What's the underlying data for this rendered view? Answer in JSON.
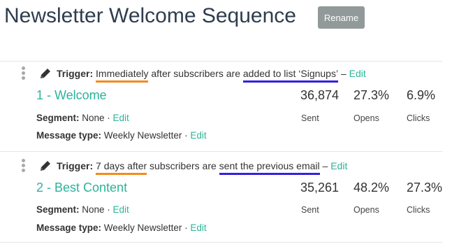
{
  "page": {
    "title": "Newsletter Welcome Sequence",
    "rename_label": "Rename"
  },
  "emails": [
    {
      "trigger_label": "Trigger:",
      "trigger_when": "Immediately",
      "trigger_mid": " after subscribers are ",
      "trigger_action": "added to list ‘Signups’",
      "trigger_sep": " – ",
      "trigger_edit": "Edit",
      "name": "1 - Welcome",
      "segment_label": "Segment:",
      "segment_value": " None · ",
      "segment_edit": "Edit",
      "type_label": "Message type:",
      "type_value": " Weekly Newsletter · ",
      "type_edit": "Edit",
      "sent": "36,874",
      "sent_label": "Sent",
      "opens": "27.3%",
      "opens_label": "Opens",
      "clicks": "6.9%",
      "clicks_label": "Clicks"
    },
    {
      "trigger_label": "Trigger:",
      "trigger_when": "7 days after",
      "trigger_mid": " subscribers are ",
      "trigger_action": "sent the previous email",
      "trigger_sep": " – ",
      "trigger_edit": "Edit",
      "name": "2 - Best Content",
      "segment_label": "Segment:",
      "segment_value": " None · ",
      "segment_edit": "Edit",
      "type_label": "Message type:",
      "type_value": " Weekly Newsletter · ",
      "type_edit": "Edit",
      "sent": "35,261",
      "sent_label": "Sent",
      "opens": "48.2%",
      "opens_label": "Opens",
      "clicks": "27.3%",
      "clicks_label": "Clicks"
    }
  ],
  "icons": {
    "drag": "drag-handle-icon",
    "edit": "pencil-icon"
  },
  "colors": {
    "accent": "#2cb39a",
    "title": "#2e3d4e",
    "button": "#929a99",
    "highlight_when": "#f28c1e",
    "highlight_action": "#3320e0"
  }
}
